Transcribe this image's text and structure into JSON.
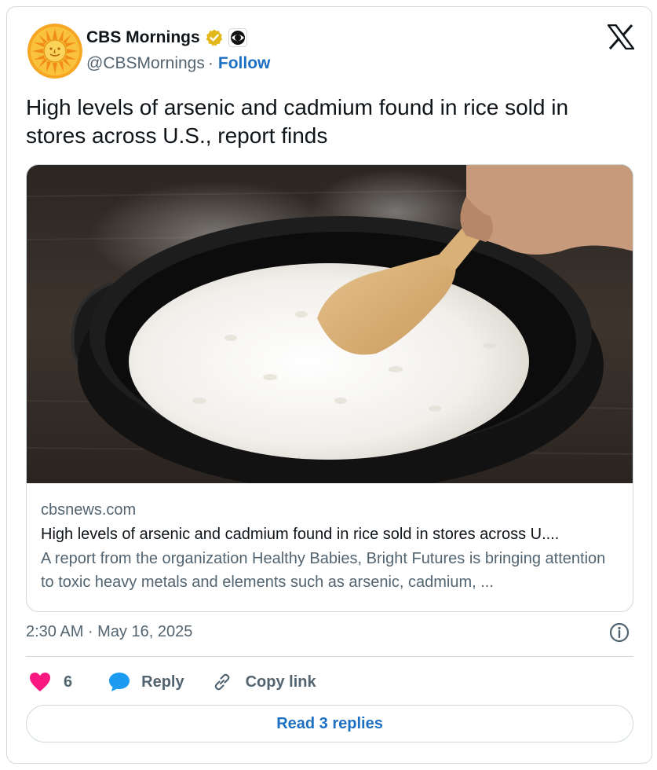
{
  "author": {
    "display_name": "CBS Mornings",
    "handle": "@CBSMornings",
    "separator": "·",
    "follow_label": "Follow"
  },
  "tweet": {
    "text": "High levels of arsenic and cadmium found in rice sold in stores across U.S., report finds"
  },
  "link_card": {
    "domain": "cbsnews.com",
    "title": "High levels of arsenic and cadmium found in rice sold in stores across U....",
    "description": "A report from the organization Healthy Babies, Bright Futures is bringing attention to toxic heavy metals and elements such as arsenic, cadmium, ..."
  },
  "timestamp": "2:30 AM · May 16, 2025",
  "actions": {
    "like_count": "6",
    "reply_label": "Reply",
    "copy_link_label": "Copy link"
  },
  "read_replies_label": "Read 3 replies",
  "colors": {
    "accent_blue": "#1d6fc2",
    "like_pink": "#f91880",
    "reply_blue": "#1d9bf0",
    "verified_gold": "#e2b719",
    "secondary_text": "#536471",
    "border": "#cfd9de"
  },
  "icons": [
    "cbs-sun-logo-icon",
    "verified-badge-icon",
    "cbs-eye-icon",
    "x-logo-icon",
    "info-icon",
    "heart-icon",
    "reply-bubble-icon",
    "link-icon"
  ]
}
